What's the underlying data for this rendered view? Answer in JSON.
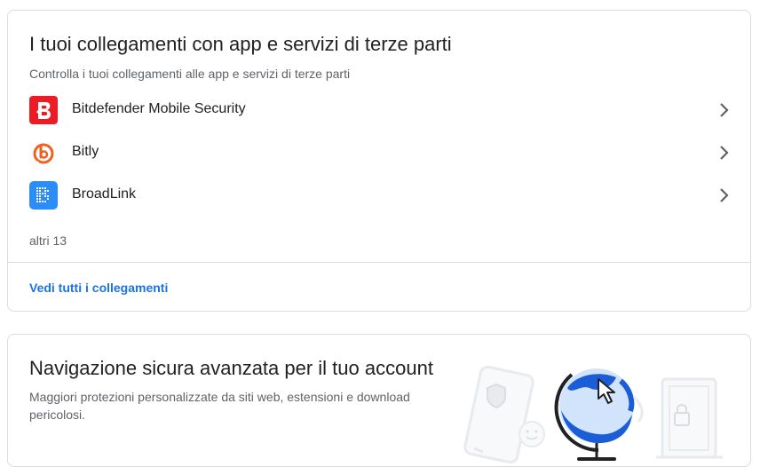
{
  "connections": {
    "title": "I tuoi collegamenti con app e servizi di terze parti",
    "subtitle": "Controlla i tuoi collegamenti alle app e servizi di terze parti",
    "apps": [
      {
        "name": "Bitdefender Mobile Security",
        "icon": "bitdefender-icon",
        "color": "#ed1c24"
      },
      {
        "name": "Bitly",
        "icon": "bitly-icon",
        "color": "#ee6123"
      },
      {
        "name": "BroadLink",
        "icon": "broadlink-icon",
        "color": "#2b8df7"
      }
    ],
    "more_label": "altri 13",
    "view_all_label": "Vedi tutti i collegamenti"
  },
  "safe_browsing": {
    "title": "Navigazione sicura avanzata per il tuo account",
    "description": "Maggiori protezioni personalizzate da siti web, estensioni e download pericolosi."
  },
  "colors": {
    "link": "#1a73e8",
    "border": "#dadce0",
    "secondary_text": "#5f6368",
    "illustration_blue": "#1a5dd6",
    "illustration_light": "#d2e3fc"
  }
}
